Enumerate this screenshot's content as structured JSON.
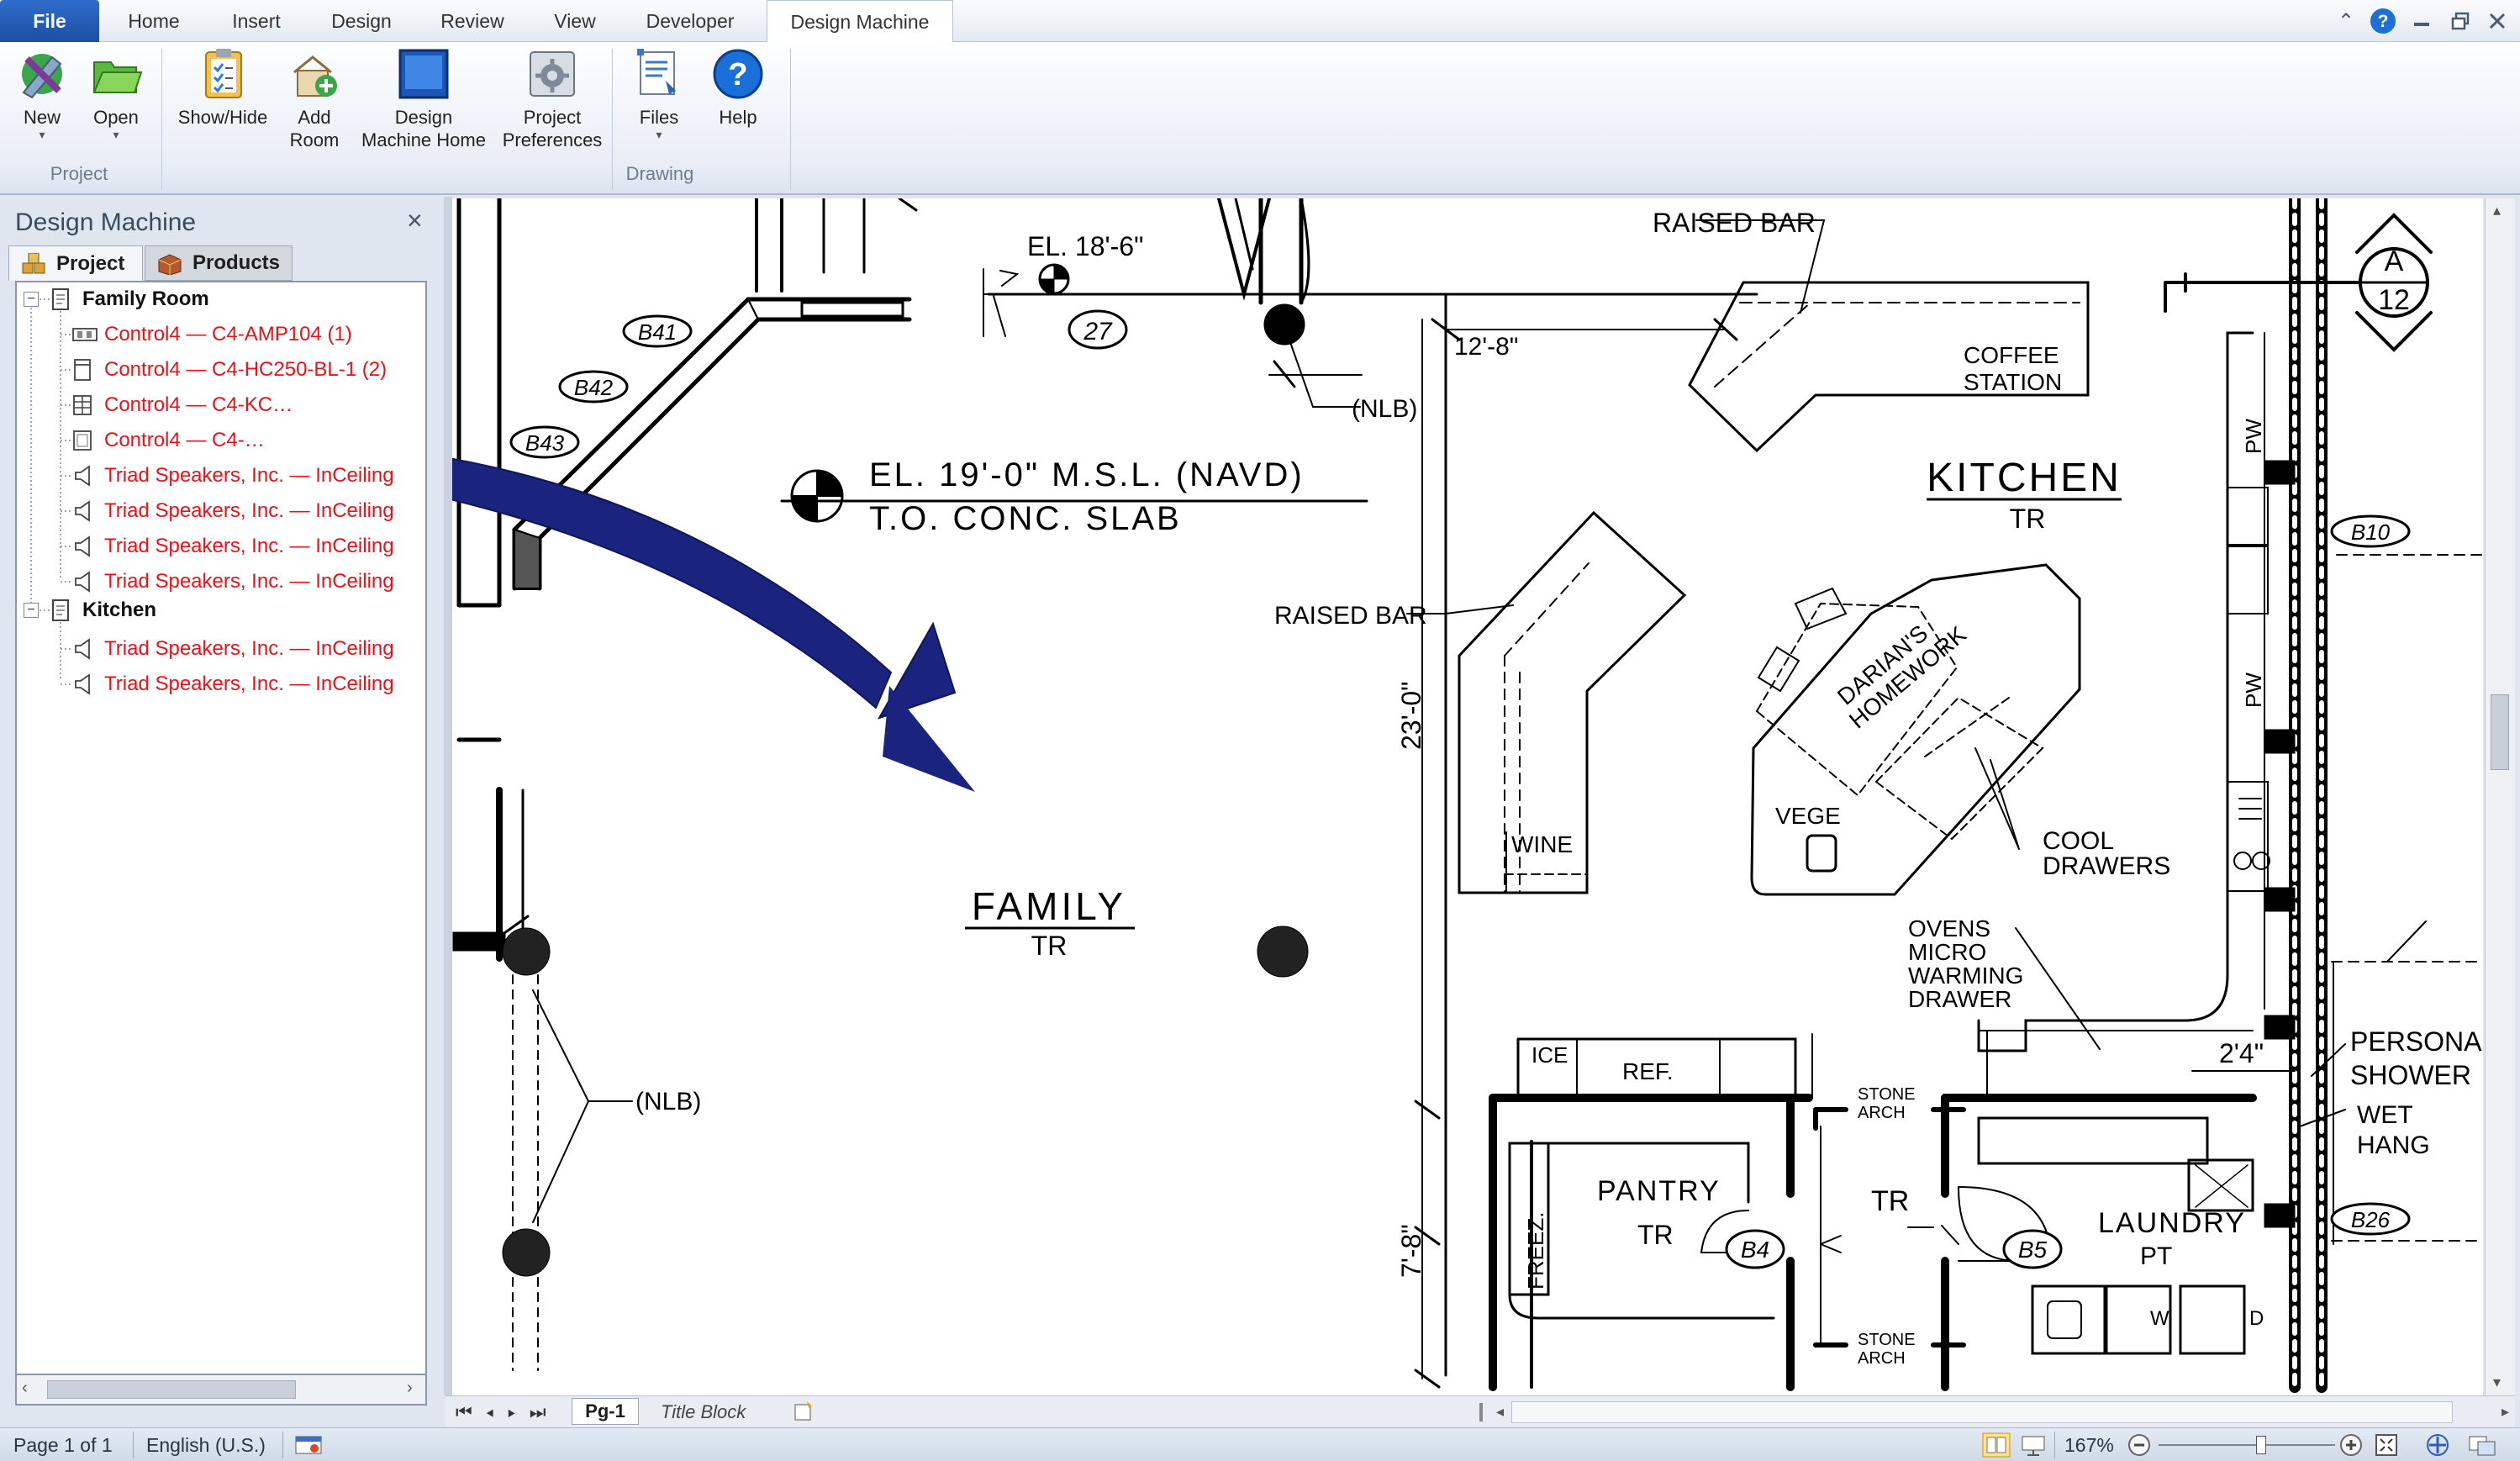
{
  "ribbon_tabs": [
    "File",
    "Home",
    "Insert",
    "Design",
    "Review",
    "View",
    "Developer",
    "Design Machine"
  ],
  "ribbon": {
    "buttons": {
      "new": "New",
      "open": "Open",
      "show_hide": "Show/Hide",
      "add_room_1": "Add",
      "add_room_2": "Room",
      "design_home_1": "Design",
      "design_home_2": "Machine Home",
      "project_prefs_1": "Project",
      "project_prefs_2": "Preferences",
      "files": "Files",
      "help": "Help"
    },
    "groups": {
      "project": "Project",
      "drawing": "Drawing"
    }
  },
  "panel": {
    "title": "Design Machine",
    "close": "×",
    "tabs": {
      "project": "Project",
      "products": "Products"
    },
    "tree": [
      {
        "label": "Family Room",
        "kind": "room",
        "children": [
          {
            "label": "Control4 — C4-AMP104 (1)",
            "icon": "amplifier-icon"
          },
          {
            "label": "Control4 — C4-HC250-BL-1 (2)",
            "icon": "controller-icon"
          },
          {
            "label": "Control4 — C4-KC…",
            "icon": "keypad-icon"
          },
          {
            "label": "Control4 — C4-…",
            "icon": "touchscreen-icon"
          },
          {
            "label": "Triad Speakers, Inc. — InCeiling",
            "icon": "speaker-icon"
          },
          {
            "label": "Triad Speakers, Inc. — InCeiling",
            "icon": "speaker-icon"
          },
          {
            "label": "Triad Speakers, Inc. — InCeiling",
            "icon": "speaker-icon"
          },
          {
            "label": "Triad Speakers, Inc. — InCeiling",
            "icon": "speaker-icon"
          }
        ]
      },
      {
        "label": "Kitchen",
        "kind": "room",
        "children": [
          {
            "label": "Triad Speakers, Inc. — InCeiling",
            "icon": "speaker-icon"
          },
          {
            "label": "Triad Speakers, Inc. — InCeiling",
            "icon": "speaker-icon"
          }
        ]
      }
    ]
  },
  "drawing": {
    "family": "FAMILY",
    "family_sub": "TR",
    "kitchen": "KITCHEN",
    "kitchen_sub": "TR",
    "elev_1": "EL. 19'-0\" M.S.L. (NAVD)",
    "elev_2": "T.O. CONC. SLAB",
    "el_top": "EL. 18'-6\"",
    "dim_12_8": "12'-8\"",
    "dim_23_0": "23'-0\"",
    "dim_7_8": "7'-8\"",
    "dim_2_4": "2'4\"",
    "nlb": "(NLB)",
    "raised_bar": "RAISED BAR",
    "raised_bar_2": "RAISED BAR",
    "coffee_1": "COFFEE",
    "coffee_2": "STATION",
    "wine": "WINE",
    "vege": "VEGE",
    "homework_1": "DARIAN'S",
    "homework_2": "HOMEWORK",
    "cool_1": "COOL",
    "cool_2": "DRAWERS",
    "ovens": [
      "OVENS",
      "MICRO",
      "WARMING",
      "DRAWER"
    ],
    "pantry": "PANTRY",
    "pantry_sub": "TR",
    "laundry": "LAUNDRY",
    "laundry_sub": "PT",
    "tr": "TR",
    "freez": "FREEZ.",
    "ref": "REF.",
    "ice": "ICE",
    "stone_arch": [
      "STONE",
      "ARCH"
    ],
    "personal_shower": [
      "PERSONAL",
      "SHOWER"
    ],
    "wet_hang": [
      "WET",
      "HANG"
    ],
    "w": "W",
    "d": "D",
    "pw": "PW",
    "tags": [
      "B41",
      "B42",
      "B43",
      "27",
      "B4",
      "B5",
      "B10",
      "B26"
    ],
    "section_mark": [
      "A",
      "12"
    ]
  },
  "pages": {
    "page1": "Pg-1",
    "title_block": "Title Block"
  },
  "status": {
    "page": "Page 1 of 1",
    "language": "English (U.S.)",
    "zoom": "167%"
  },
  "colors": {
    "tree_item": "#e8121b",
    "arrow": "#1a237e",
    "file_tab": "#2a63c0"
  }
}
